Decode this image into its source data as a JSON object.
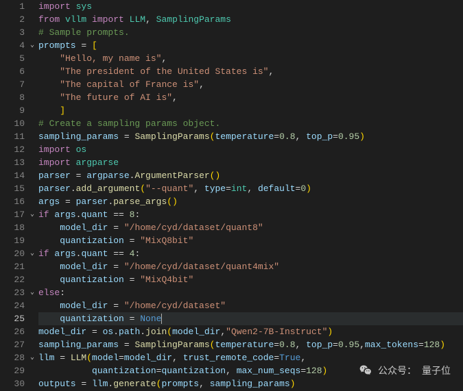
{
  "watermark": {
    "prefix": "公众号：",
    "name": "量子位"
  },
  "current_line": 25,
  "fold_markers": [
    {
      "line": 4,
      "glyph": "⌄"
    },
    {
      "line": 17,
      "glyph": "⌄"
    },
    {
      "line": 20,
      "glyph": "⌄"
    },
    {
      "line": 23,
      "glyph": "⌄"
    },
    {
      "line": 28,
      "glyph": "⌄"
    }
  ],
  "lines": [
    {
      "n": 1,
      "tokens": [
        [
          "kw",
          "import "
        ],
        [
          "mod",
          "sys"
        ]
      ]
    },
    {
      "n": 2,
      "tokens": [
        [
          "kw",
          "from "
        ],
        [
          "mod",
          "vllm"
        ],
        [
          "kw",
          " import "
        ],
        [
          "mod",
          "LLM"
        ],
        [
          "pun",
          ", "
        ],
        [
          "mod",
          "SamplingParams"
        ]
      ]
    },
    {
      "n": 3,
      "tokens": [
        [
          "cmt",
          "# Sample prompts."
        ]
      ]
    },
    {
      "n": 4,
      "tokens": [
        [
          "var",
          "prompts"
        ],
        [
          "op",
          " = "
        ],
        [
          "gold",
          "["
        ]
      ]
    },
    {
      "n": 5,
      "tokens": [
        [
          "pun",
          "    "
        ],
        [
          "str",
          "\"Hello, my name is\""
        ],
        [
          "pun",
          ","
        ]
      ]
    },
    {
      "n": 6,
      "tokens": [
        [
          "pun",
          "    "
        ],
        [
          "str",
          "\"The president of the United States is\""
        ],
        [
          "pun",
          ","
        ]
      ]
    },
    {
      "n": 7,
      "tokens": [
        [
          "pun",
          "    "
        ],
        [
          "str",
          "\"The capital of France is\""
        ],
        [
          "pun",
          ","
        ]
      ]
    },
    {
      "n": 8,
      "tokens": [
        [
          "pun",
          "    "
        ],
        [
          "str",
          "\"The future of AI is\""
        ],
        [
          "pun",
          ","
        ]
      ]
    },
    {
      "n": 9,
      "tokens": [
        [
          "pun",
          "    "
        ],
        [
          "gold",
          "]"
        ]
      ]
    },
    {
      "n": 10,
      "tokens": [
        [
          "cmt",
          "# Create a sampling params object."
        ]
      ]
    },
    {
      "n": 11,
      "tokens": [
        [
          "var",
          "sampling_params"
        ],
        [
          "op",
          " = "
        ],
        [
          "fn",
          "SamplingParams"
        ],
        [
          "gold",
          "("
        ],
        [
          "var",
          "temperature"
        ],
        [
          "op",
          "="
        ],
        [
          "num",
          "0.8"
        ],
        [
          "pun",
          ", "
        ],
        [
          "var",
          "top_p"
        ],
        [
          "op",
          "="
        ],
        [
          "num",
          "0.95"
        ],
        [
          "gold",
          ")"
        ]
      ]
    },
    {
      "n": 12,
      "tokens": [
        [
          "kw",
          "import "
        ],
        [
          "mod",
          "os"
        ]
      ]
    },
    {
      "n": 13,
      "tokens": [
        [
          "kw",
          "import "
        ],
        [
          "mod",
          "argparse"
        ]
      ]
    },
    {
      "n": 14,
      "tokens": [
        [
          "var",
          "parser"
        ],
        [
          "op",
          " = "
        ],
        [
          "var",
          "argparse"
        ],
        [
          "pun",
          "."
        ],
        [
          "fn",
          "ArgumentParser"
        ],
        [
          "gold",
          "("
        ],
        [
          "gold",
          ")"
        ]
      ]
    },
    {
      "n": 15,
      "tokens": [
        [
          "var",
          "parser"
        ],
        [
          "pun",
          "."
        ],
        [
          "fn",
          "add_argument"
        ],
        [
          "gold",
          "("
        ],
        [
          "str",
          "\"--quant\""
        ],
        [
          "pun",
          ", "
        ],
        [
          "var",
          "type"
        ],
        [
          "op",
          "="
        ],
        [
          "mod",
          "int"
        ],
        [
          "pun",
          ", "
        ],
        [
          "var",
          "default"
        ],
        [
          "op",
          "="
        ],
        [
          "num",
          "0"
        ],
        [
          "gold",
          ")"
        ]
      ]
    },
    {
      "n": 16,
      "tokens": [
        [
          "var",
          "args"
        ],
        [
          "op",
          " = "
        ],
        [
          "var",
          "parser"
        ],
        [
          "pun",
          "."
        ],
        [
          "fn",
          "parse_args"
        ],
        [
          "gold",
          "("
        ],
        [
          "gold",
          ")"
        ]
      ]
    },
    {
      "n": 17,
      "tokens": [
        [
          "kw",
          "if "
        ],
        [
          "var",
          "args"
        ],
        [
          "pun",
          "."
        ],
        [
          "var",
          "quant"
        ],
        [
          "op",
          " == "
        ],
        [
          "num",
          "8"
        ],
        [
          "pun",
          ":"
        ]
      ]
    },
    {
      "n": 18,
      "tokens": [
        [
          "pun",
          "    "
        ],
        [
          "var",
          "model_dir"
        ],
        [
          "op",
          " = "
        ],
        [
          "str",
          "\"/home/cyd/dataset/quant8\""
        ]
      ]
    },
    {
      "n": 19,
      "tokens": [
        [
          "pun",
          "    "
        ],
        [
          "var",
          "quantization"
        ],
        [
          "op",
          " = "
        ],
        [
          "str",
          "\"MixQ8bit\""
        ]
      ]
    },
    {
      "n": 20,
      "tokens": [
        [
          "kw",
          "if "
        ],
        [
          "var",
          "args"
        ],
        [
          "pun",
          "."
        ],
        [
          "var",
          "quant"
        ],
        [
          "op",
          " == "
        ],
        [
          "num",
          "4"
        ],
        [
          "pun",
          ":"
        ]
      ]
    },
    {
      "n": 21,
      "tokens": [
        [
          "pun",
          "    "
        ],
        [
          "var",
          "model_dir"
        ],
        [
          "op",
          " = "
        ],
        [
          "str",
          "\"/home/cyd/dataset/quant4mix\""
        ]
      ]
    },
    {
      "n": 22,
      "tokens": [
        [
          "pun",
          "    "
        ],
        [
          "var",
          "quantization"
        ],
        [
          "op",
          " = "
        ],
        [
          "str",
          "\"MixQ4bit\""
        ]
      ]
    },
    {
      "n": 23,
      "tokens": [
        [
          "kw",
          "else"
        ],
        [
          "pun",
          ":"
        ]
      ]
    },
    {
      "n": 24,
      "tokens": [
        [
          "pun",
          "    "
        ],
        [
          "var",
          "model_dir"
        ],
        [
          "op",
          " = "
        ],
        [
          "str",
          "\"/home/cyd/dataset\""
        ]
      ]
    },
    {
      "n": 25,
      "tokens": [
        [
          "pun",
          "    "
        ],
        [
          "var",
          "quantization"
        ],
        [
          "op",
          " = "
        ],
        [
          "bl",
          "None"
        ]
      ]
    },
    {
      "n": 26,
      "tokens": [
        [
          "var",
          "model_dir"
        ],
        [
          "op",
          " = "
        ],
        [
          "var",
          "os"
        ],
        [
          "pun",
          "."
        ],
        [
          "var",
          "path"
        ],
        [
          "pun",
          "."
        ],
        [
          "fn",
          "join"
        ],
        [
          "gold",
          "("
        ],
        [
          "var",
          "model_dir"
        ],
        [
          "pun",
          ","
        ],
        [
          "str",
          "\"Qwen2-7B-Instruct\""
        ],
        [
          "gold",
          ")"
        ]
      ]
    },
    {
      "n": 27,
      "tokens": [
        [
          "var",
          "sampling_params"
        ],
        [
          "op",
          " = "
        ],
        [
          "fn",
          "SamplingParams"
        ],
        [
          "gold",
          "("
        ],
        [
          "var",
          "temperature"
        ],
        [
          "op",
          "="
        ],
        [
          "num",
          "0.8"
        ],
        [
          "pun",
          ", "
        ],
        [
          "var",
          "top_p"
        ],
        [
          "op",
          "="
        ],
        [
          "num",
          "0.95"
        ],
        [
          "pun",
          ","
        ],
        [
          "var",
          "max_tokens"
        ],
        [
          "op",
          "="
        ],
        [
          "num",
          "128"
        ],
        [
          "gold",
          ")"
        ]
      ]
    },
    {
      "n": 28,
      "tokens": [
        [
          "var",
          "llm"
        ],
        [
          "op",
          " = "
        ],
        [
          "fn",
          "LLM"
        ],
        [
          "gold",
          "("
        ],
        [
          "var",
          "model"
        ],
        [
          "op",
          "="
        ],
        [
          "var",
          "model_dir"
        ],
        [
          "pun",
          ", "
        ],
        [
          "var",
          "trust_remote_code"
        ],
        [
          "op",
          "="
        ],
        [
          "bl",
          "True"
        ],
        [
          "pun",
          ","
        ]
      ]
    },
    {
      "n": 29,
      "tokens": [
        [
          "pun",
          "          "
        ],
        [
          "var",
          "quantization"
        ],
        [
          "op",
          "="
        ],
        [
          "var",
          "quantization"
        ],
        [
          "pun",
          ", "
        ],
        [
          "var",
          "max_num_seqs"
        ],
        [
          "op",
          "="
        ],
        [
          "num",
          "128"
        ],
        [
          "gold",
          ")"
        ]
      ]
    },
    {
      "n": 30,
      "tokens": [
        [
          "var",
          "outputs"
        ],
        [
          "op",
          " = "
        ],
        [
          "var",
          "llm"
        ],
        [
          "pun",
          "."
        ],
        [
          "fn",
          "generate"
        ],
        [
          "gold",
          "("
        ],
        [
          "var",
          "prompts"
        ],
        [
          "pun",
          ", "
        ],
        [
          "var",
          "sampling_params"
        ],
        [
          "gold",
          ")"
        ]
      ]
    }
  ]
}
